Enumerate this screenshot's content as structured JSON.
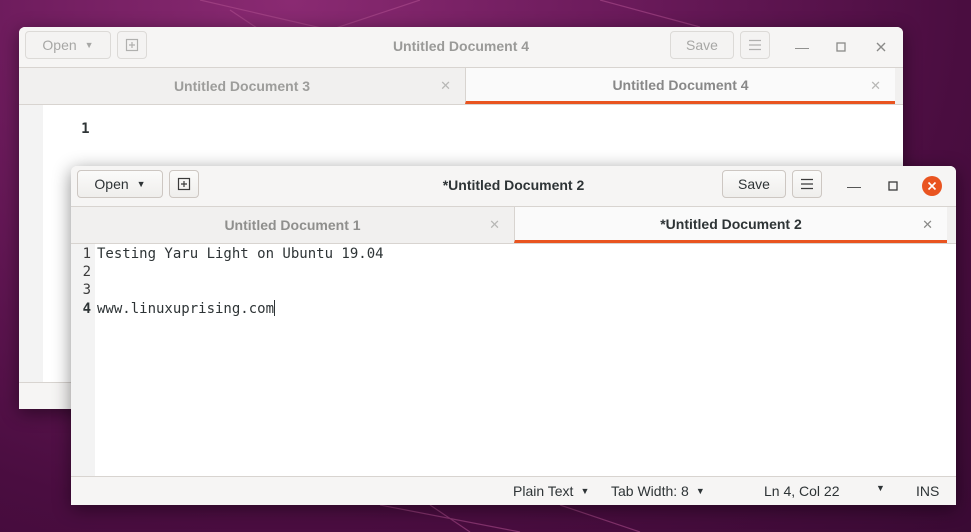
{
  "colors": {
    "accent": "#e95420",
    "desktop": "#5a1450",
    "close_button": "#e95420"
  },
  "back_window": {
    "title": "Untitled Document 4",
    "open_label": "Open",
    "save_label": "Save",
    "tabs": [
      {
        "label": "Untitled Document 3",
        "active": false
      },
      {
        "label": "Untitled Document 4",
        "active": true
      }
    ],
    "lines": [
      {
        "number": "1",
        "text": ""
      }
    ]
  },
  "front_window": {
    "title": "*Untitled Document 2",
    "open_label": "Open",
    "save_label": "Save",
    "tabs": [
      {
        "label": "Untitled Document 1",
        "active": false
      },
      {
        "label": "*Untitled Document 2",
        "active": true
      }
    ],
    "lines": [
      {
        "number": "1",
        "text": "Testing Yaru Light on Ubuntu 19.04"
      },
      {
        "number": "2",
        "text": ""
      },
      {
        "number": "3",
        "text": ""
      },
      {
        "number": "4",
        "text": "www.linuxuprising.com"
      }
    ],
    "status": {
      "language": "Plain Text",
      "tab_width": "Tab Width: 8",
      "position": "Ln 4, Col 22",
      "mode": "INS"
    }
  },
  "icons": [
    "new-tab-icon",
    "hamburger-menu-icon",
    "minimize-icon",
    "maximize-icon",
    "close-icon",
    "chevron-down-icon",
    "tab-close-icon"
  ]
}
